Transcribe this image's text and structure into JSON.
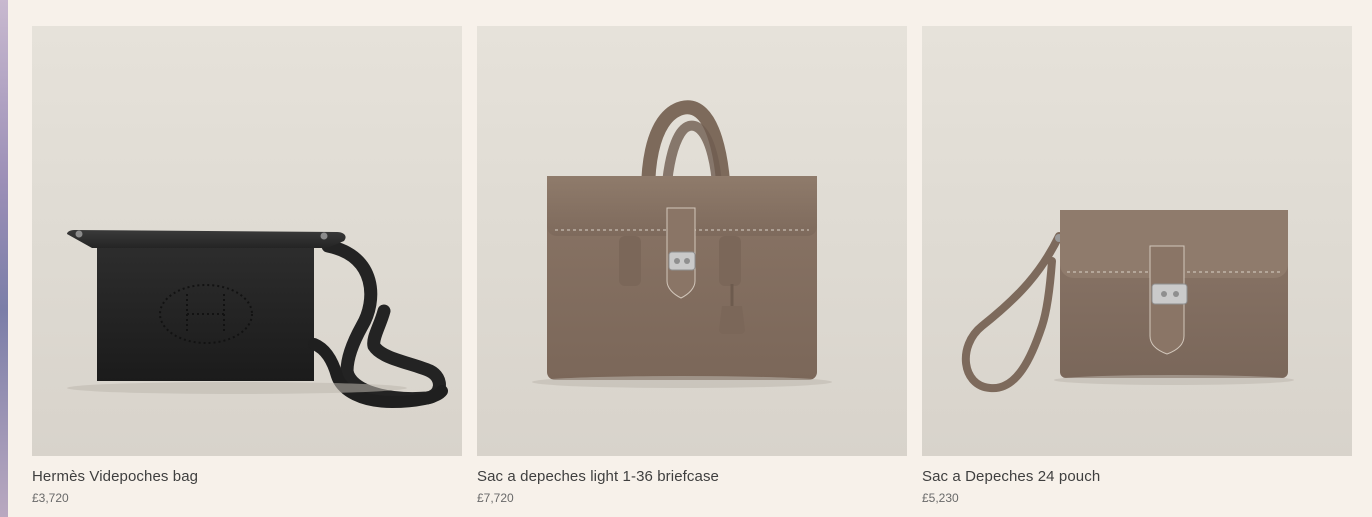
{
  "products": [
    {
      "title": "Hermès Videpoches bag",
      "price": "£3,720",
      "icon": "black-leather-crossbody-bag-icon",
      "accent": "#2b2b2b"
    },
    {
      "title": "Sac a depeches light 1-36 briefcase",
      "price": "£7,720",
      "icon": "taupe-leather-briefcase-icon",
      "accent": "#8a7566"
    },
    {
      "title": "Sac a Depeches 24 pouch",
      "price": "£5,230",
      "icon": "taupe-leather-wristlet-pouch-icon",
      "accent": "#8a7566"
    }
  ]
}
